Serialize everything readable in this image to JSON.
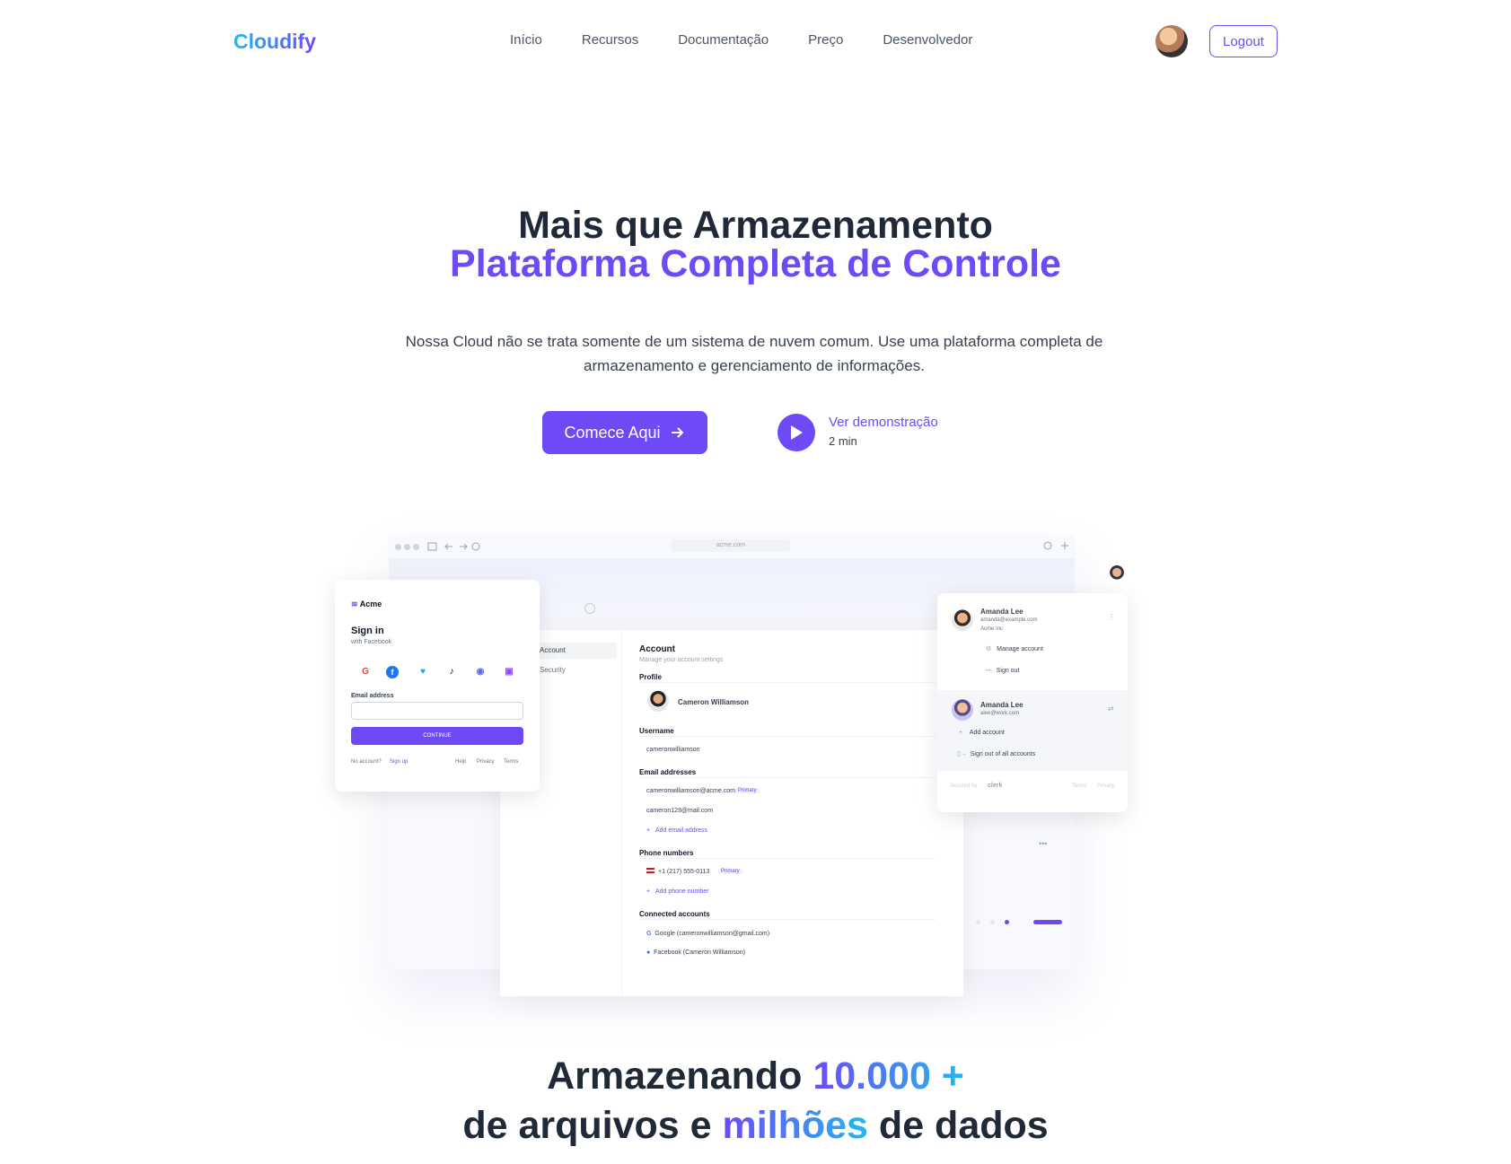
{
  "brand": "Cloudify",
  "nav": [
    "Início",
    "Recursos",
    "Documentação",
    "Preço",
    "Desenvolvedor"
  ],
  "header": {
    "logout": "Logout"
  },
  "hero": {
    "line1": "Mais que Armazenamento",
    "line2": "Plataforma Completa de Controle",
    "subtitle": "Nossa Cloud não se trata somente de um sistema de nuvem comum. Use uma plataforma completa de armazenamento e gerenciamento de informações.",
    "cta": "Comece Aqui",
    "demo_title": "Ver demonstração",
    "demo_duration": "2 min"
  },
  "mockup": {
    "url": "acme.com",
    "signin": {
      "brand": "Acme",
      "title": "Sign in",
      "subtitle": "with Facebook",
      "email_label": "Email address",
      "continue": "CONTINUE",
      "no_account": "No account?",
      "signup": "Sign up",
      "links": [
        "Help",
        "Privacy",
        "Terms"
      ]
    },
    "account": {
      "side": [
        "Account",
        "Security"
      ],
      "title": "Account",
      "subtitle": "Manage your account settings",
      "profile": "Profile",
      "name": "Cameron Williamson",
      "username_label": "Username",
      "username": "cameronwilliamson",
      "emails_label": "Email addresses",
      "email1": "cameronwilliamson@acme.com",
      "primary": "Primary",
      "email2": "cameron123@mail.com",
      "add_email": "Add email address",
      "phones_label": "Phone numbers",
      "phone": "+1 (217) 555-0113",
      "add_phone": "Add phone number",
      "connected_label": "Connected accounts",
      "google": "Google (cameronwilliamson@gmail.com)",
      "facebook": "Facebook (Cameron Williamson)"
    },
    "usercard": {
      "name1": "Amanda Lee",
      "email1": "amanda@example.com",
      "org1": "Acme Inc",
      "manage": "Manage account",
      "signout": "Sign out",
      "name2": "Amanda Lee",
      "email2": "alee@work.com",
      "add": "Add account",
      "signout_all": "Sign out of all accounts",
      "secured": "Secured by",
      "clerk": "clerk",
      "terms": "Terms",
      "privacy": "Privacy"
    }
  },
  "stats": {
    "a1": "Armazenando ",
    "a2": "10.000 +",
    "b1": "de arquivos e ",
    "b2": "milhões",
    "b3": " de dados"
  },
  "colors": {
    "accent": "#6d4af6",
    "cyan": "#22b8f0",
    "text": "#1f2937"
  }
}
